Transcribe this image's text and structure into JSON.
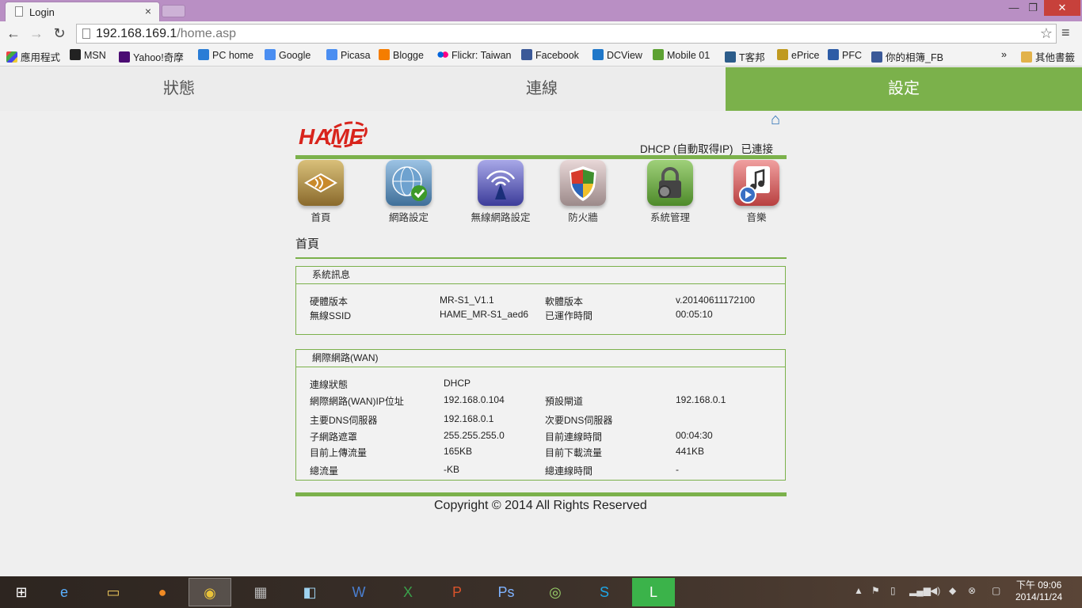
{
  "browser": {
    "tab_title": "Login",
    "tab_close": "×",
    "window_min": "—",
    "window_max": "❐",
    "window_close": "✕",
    "url_host": "192.168.169.1",
    "url_path": "/home.asp",
    "bookmarks": [
      "應用程式",
      "MSN",
      "Yahoo!奇摩",
      "PC home",
      "Google",
      "Picasa",
      "Blogge",
      "Flickr: Taiwan",
      "Facebook",
      "DCView",
      "Mobile 01",
      "T客邦",
      "ePrice",
      "PFC",
      "你的相簿_FB"
    ],
    "bookmarks_more": "»",
    "other_bookmarks": "其他書籤"
  },
  "topnav": {
    "status": "狀態",
    "connection": "連線",
    "settings": "設定"
  },
  "header": {
    "logo_text": "HAME",
    "connection_mode": "DHCP (自動取得IP)",
    "connection_state": "已連接"
  },
  "icons": [
    {
      "label": "首頁"
    },
    {
      "label": "網路設定"
    },
    {
      "label": "無線網路設定"
    },
    {
      "label": "防火牆"
    },
    {
      "label": "系統管理"
    },
    {
      "label": "音樂"
    }
  ],
  "section_title": "首頁",
  "system_info": {
    "title": "系統訊息",
    "hw_label": "硬體版本",
    "hw_value": "MR-S1_V1.1",
    "fw_label": "軟體版本",
    "fw_value": "v.20140611172100",
    "ssid_label": "無線SSID",
    "ssid_value": "HAME_MR-S1_aed6",
    "uptime_label": "已運作時間",
    "uptime_value": "00:05:10"
  },
  "wan": {
    "title": "網際網路(WAN)",
    "conn_status_label": "連線狀態",
    "conn_status_value": "DHCP",
    "ip_label": "網際網路(WAN)IP位址",
    "ip_value": "192.168.0.104",
    "gateway_label": "預設閘道",
    "gateway_value": "192.168.0.1",
    "dns1_label": "主要DNS伺服器",
    "dns1_value": "192.168.0.1",
    "dns2_label": "次要DNS伺服器",
    "dns2_value": "",
    "mask_label": "子網路遮罩",
    "mask_value": "255.255.255.0",
    "conn_time_label": "目前連線時間",
    "conn_time_value": "00:04:30",
    "upload_label": "目前上傳流量",
    "upload_value": "165KB",
    "download_label": "目前下載流量",
    "download_value": "441KB",
    "total_label": "總流量",
    "total_value": "-KB",
    "total_time_label": "總連線時間",
    "total_time_value": "-"
  },
  "footer": "Copyright © 2014 All Rights Reserved",
  "taskbar": {
    "clock_period_time": "下午 09:06",
    "clock_date": "2014/11/24"
  },
  "colors": {
    "accent": "#7bb14b",
    "titlebar": "#b98fc4"
  }
}
